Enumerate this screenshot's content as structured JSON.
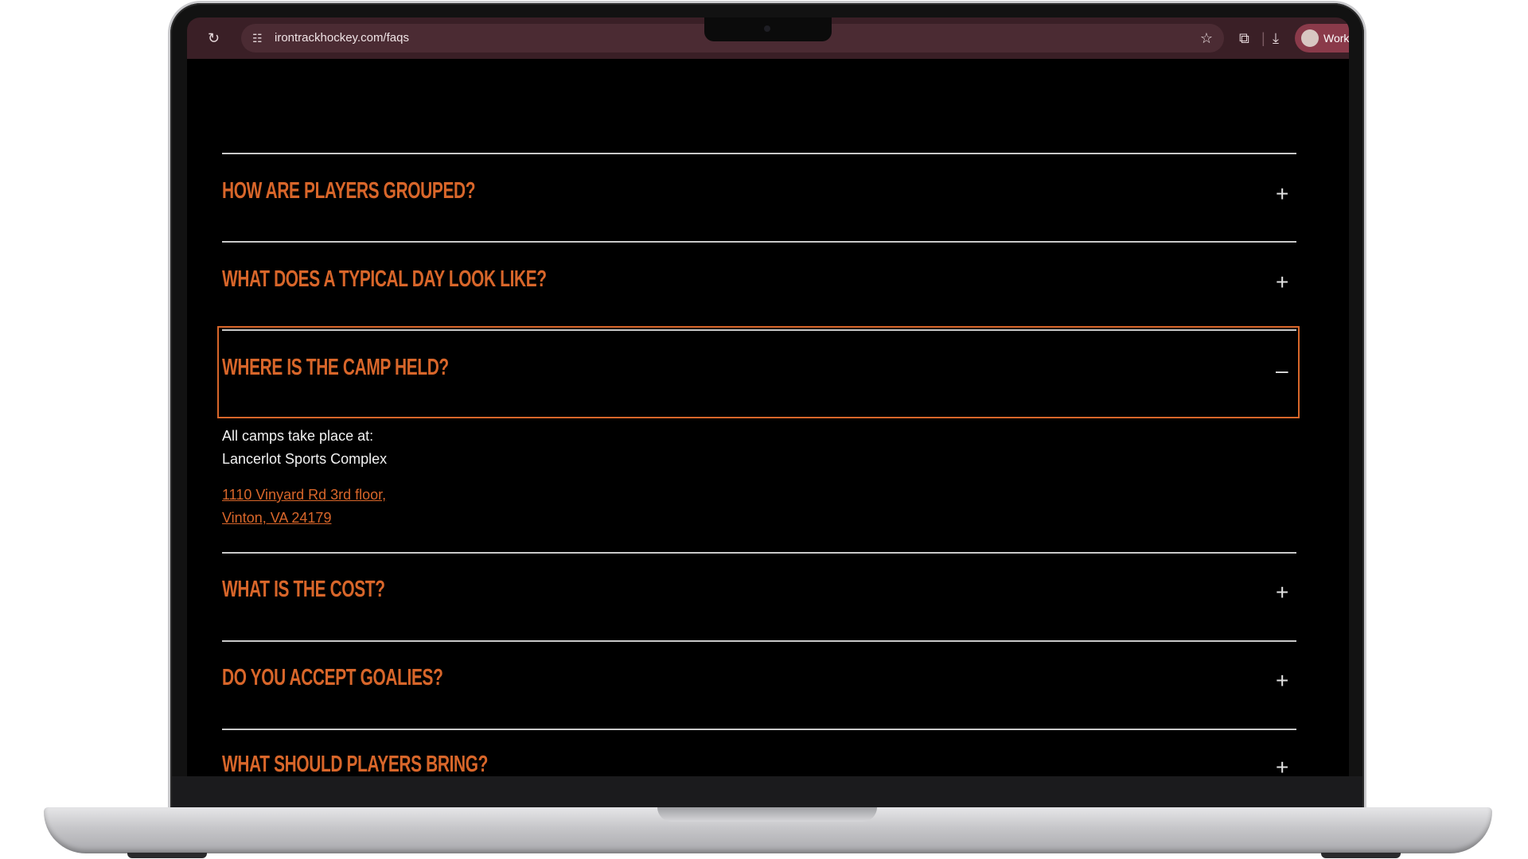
{
  "browser": {
    "url": "irontrackhockey.com/faqs",
    "profile_label": "Work",
    "icons": {
      "reload": "reload-icon",
      "site_info": "site-info-icon",
      "bookmark": "star-icon",
      "extensions": "extensions-icon",
      "download": "download-icon"
    }
  },
  "faqs": [
    {
      "question": "HOW ARE PLAYERS GROUPED?",
      "toggle": "+"
    },
    {
      "question": "WHAT DOES A TYPICAL DAY LOOK LIKE?",
      "toggle": "+"
    },
    {
      "question": "WHERE IS THE CAMP HELD?",
      "toggle": "–",
      "answer": {
        "line1": "All camps take place at:",
        "line2": "Lancerlot Sports Complex",
        "link_line1": "1110 Vinyard Rd 3rd floor,",
        "link_line2": "Vinton, VA 24179"
      }
    },
    {
      "question": "WHAT IS THE COST?",
      "toggle": "+"
    },
    {
      "question": "DO YOU ACCEPT GOALIES?",
      "toggle": "+"
    },
    {
      "question": "WHAT SHOULD PLAYERS BRING?",
      "toggle": "+"
    }
  ],
  "colors": {
    "accent": "#d8662a",
    "toolbar": "#3a1f26",
    "background": "#000000"
  }
}
